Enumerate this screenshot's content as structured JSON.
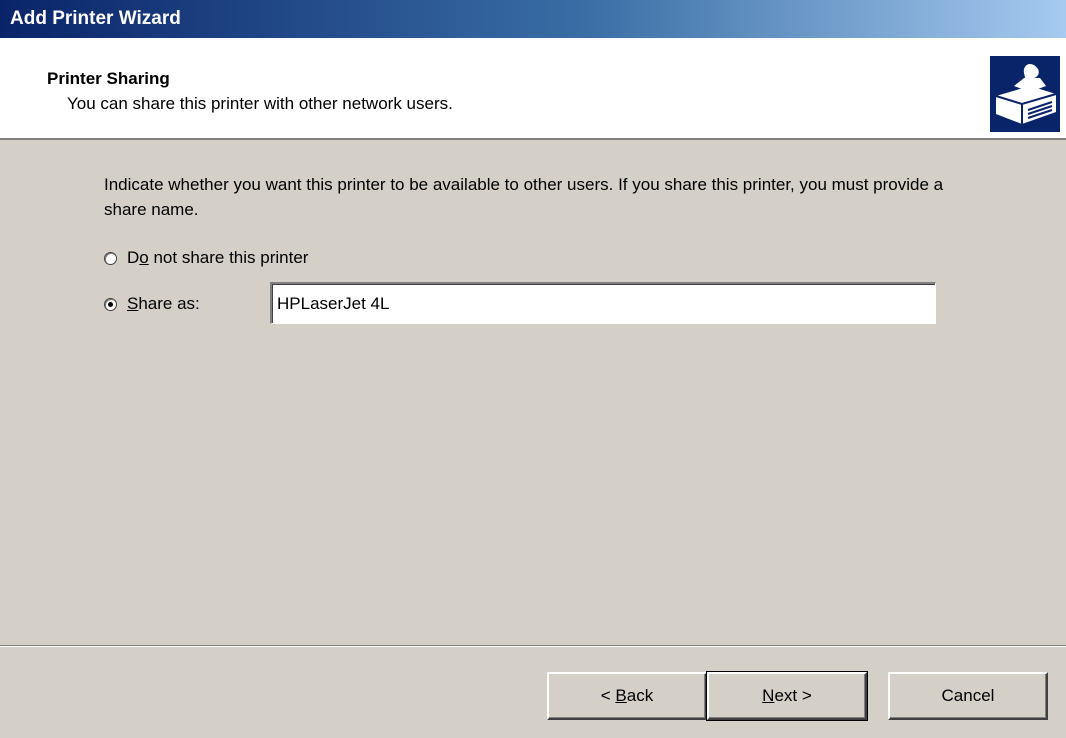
{
  "window": {
    "title": "Add Printer Wizard"
  },
  "header": {
    "title": "Printer Sharing",
    "subtitle": "You can share this printer with other network users.",
    "icon": "printer-sharing-icon"
  },
  "main": {
    "intro": "Indicate whether you want this printer to be available to other users. If you share this printer, you must provide a share name.",
    "options": [
      {
        "label_pre": "D",
        "label_key": "o",
        "label_post": " not share this printer",
        "checked": false
      },
      {
        "label_pre": "",
        "label_key": "S",
        "label_post": "hare as:",
        "checked": true
      }
    ],
    "share_name": "HPLaserJet 4L"
  },
  "buttons": {
    "back_arrow": "<",
    "back_key": "B",
    "back_rest": "ack",
    "next_key": "N",
    "next_rest": "ext",
    "next_arrow": ">",
    "cancel": "Cancel"
  },
  "colors": {
    "title_gradient_start": "#0a246a",
    "title_gradient_end": "#a6caf0",
    "face": "#d4d0c8",
    "header_bg": "#ffffff"
  }
}
